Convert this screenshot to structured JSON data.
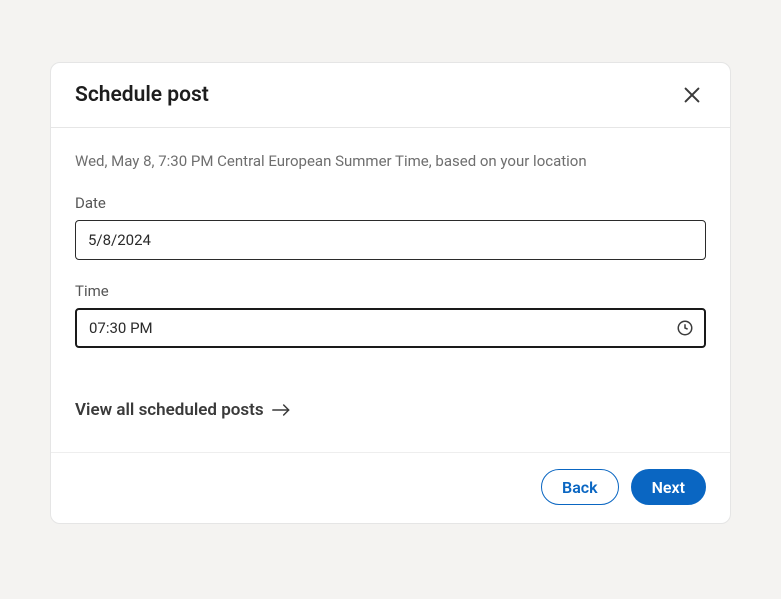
{
  "modal": {
    "title": "Schedule post",
    "timezone_info": "Wed, May 8, 7:30 PM Central European Summer Time, based on your location",
    "date": {
      "label": "Date",
      "value": "5/8/2024"
    },
    "time": {
      "label": "Time",
      "value": "07:30 PM"
    },
    "view_all_label": "View all scheduled posts"
  },
  "footer": {
    "back_label": "Back",
    "next_label": "Next"
  },
  "colors": {
    "accent": "#0a66c2"
  }
}
